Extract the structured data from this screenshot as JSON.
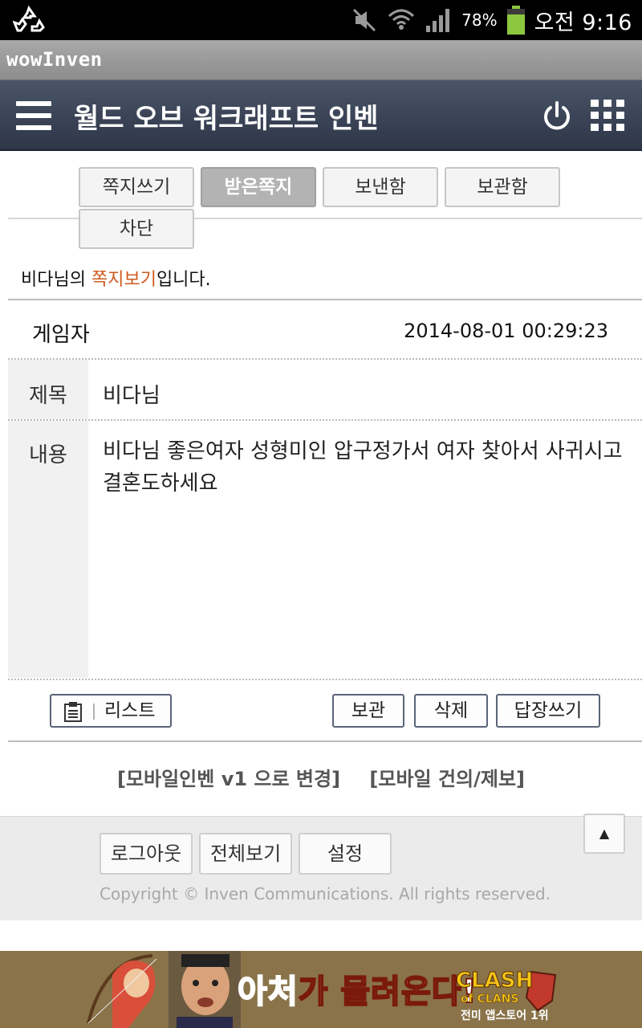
{
  "status_bar": {
    "battery_percent": "78%",
    "battery_level": 0.78,
    "time": "오전 9:16",
    "icons": [
      "recycle-icon",
      "mute-icon",
      "wifi-icon",
      "signal-icon",
      "battery-icon"
    ]
  },
  "browser": {
    "title": "wowInven"
  },
  "header": {
    "title": "월드 오브 워크래프트 인벤"
  },
  "tabs": [
    {
      "label": "쪽지쓰기",
      "active": false
    },
    {
      "label": "받은쪽지",
      "active": true
    },
    {
      "label": "보낸함",
      "active": false
    },
    {
      "label": "보관함",
      "active": false
    },
    {
      "label": "차단",
      "active": false
    }
  ],
  "notice": {
    "name": "비다",
    "suffix1": "님의 ",
    "highlight": "쪽지보기",
    "suffix2": "입니다."
  },
  "message": {
    "sender": "게임자",
    "date": "2014-08-01 00:29:23",
    "subject_label": "제목",
    "subject": "비다님",
    "content_label": "내용",
    "content": "비다님 좋은여자 성형미인 압구정가서 여자 찾아서 사귀시고 결혼도하세요"
  },
  "actions": {
    "list": "리스트",
    "archive": "보관",
    "delete": "삭제",
    "reply": "답장쓰기"
  },
  "footer_links": {
    "switch_v1": "[모바일인벤 v1 으로 변경]",
    "suggest": "[모바일 건의/제보]"
  },
  "footer": {
    "logout": "로그아웃",
    "full_view": "전체보기",
    "settings": "설정",
    "top": "▲",
    "copyright": "Copyright © Inven Communications. All rights reserved."
  },
  "ad": {
    "slogan_part1": "아",
    "slogan_part2": "처",
    "slogan_part3": "가 몰려온다!",
    "brand_line1": "CLASH",
    "brand_line2": "of CLANS",
    "sub": "전미 앱스토어 1위"
  }
}
